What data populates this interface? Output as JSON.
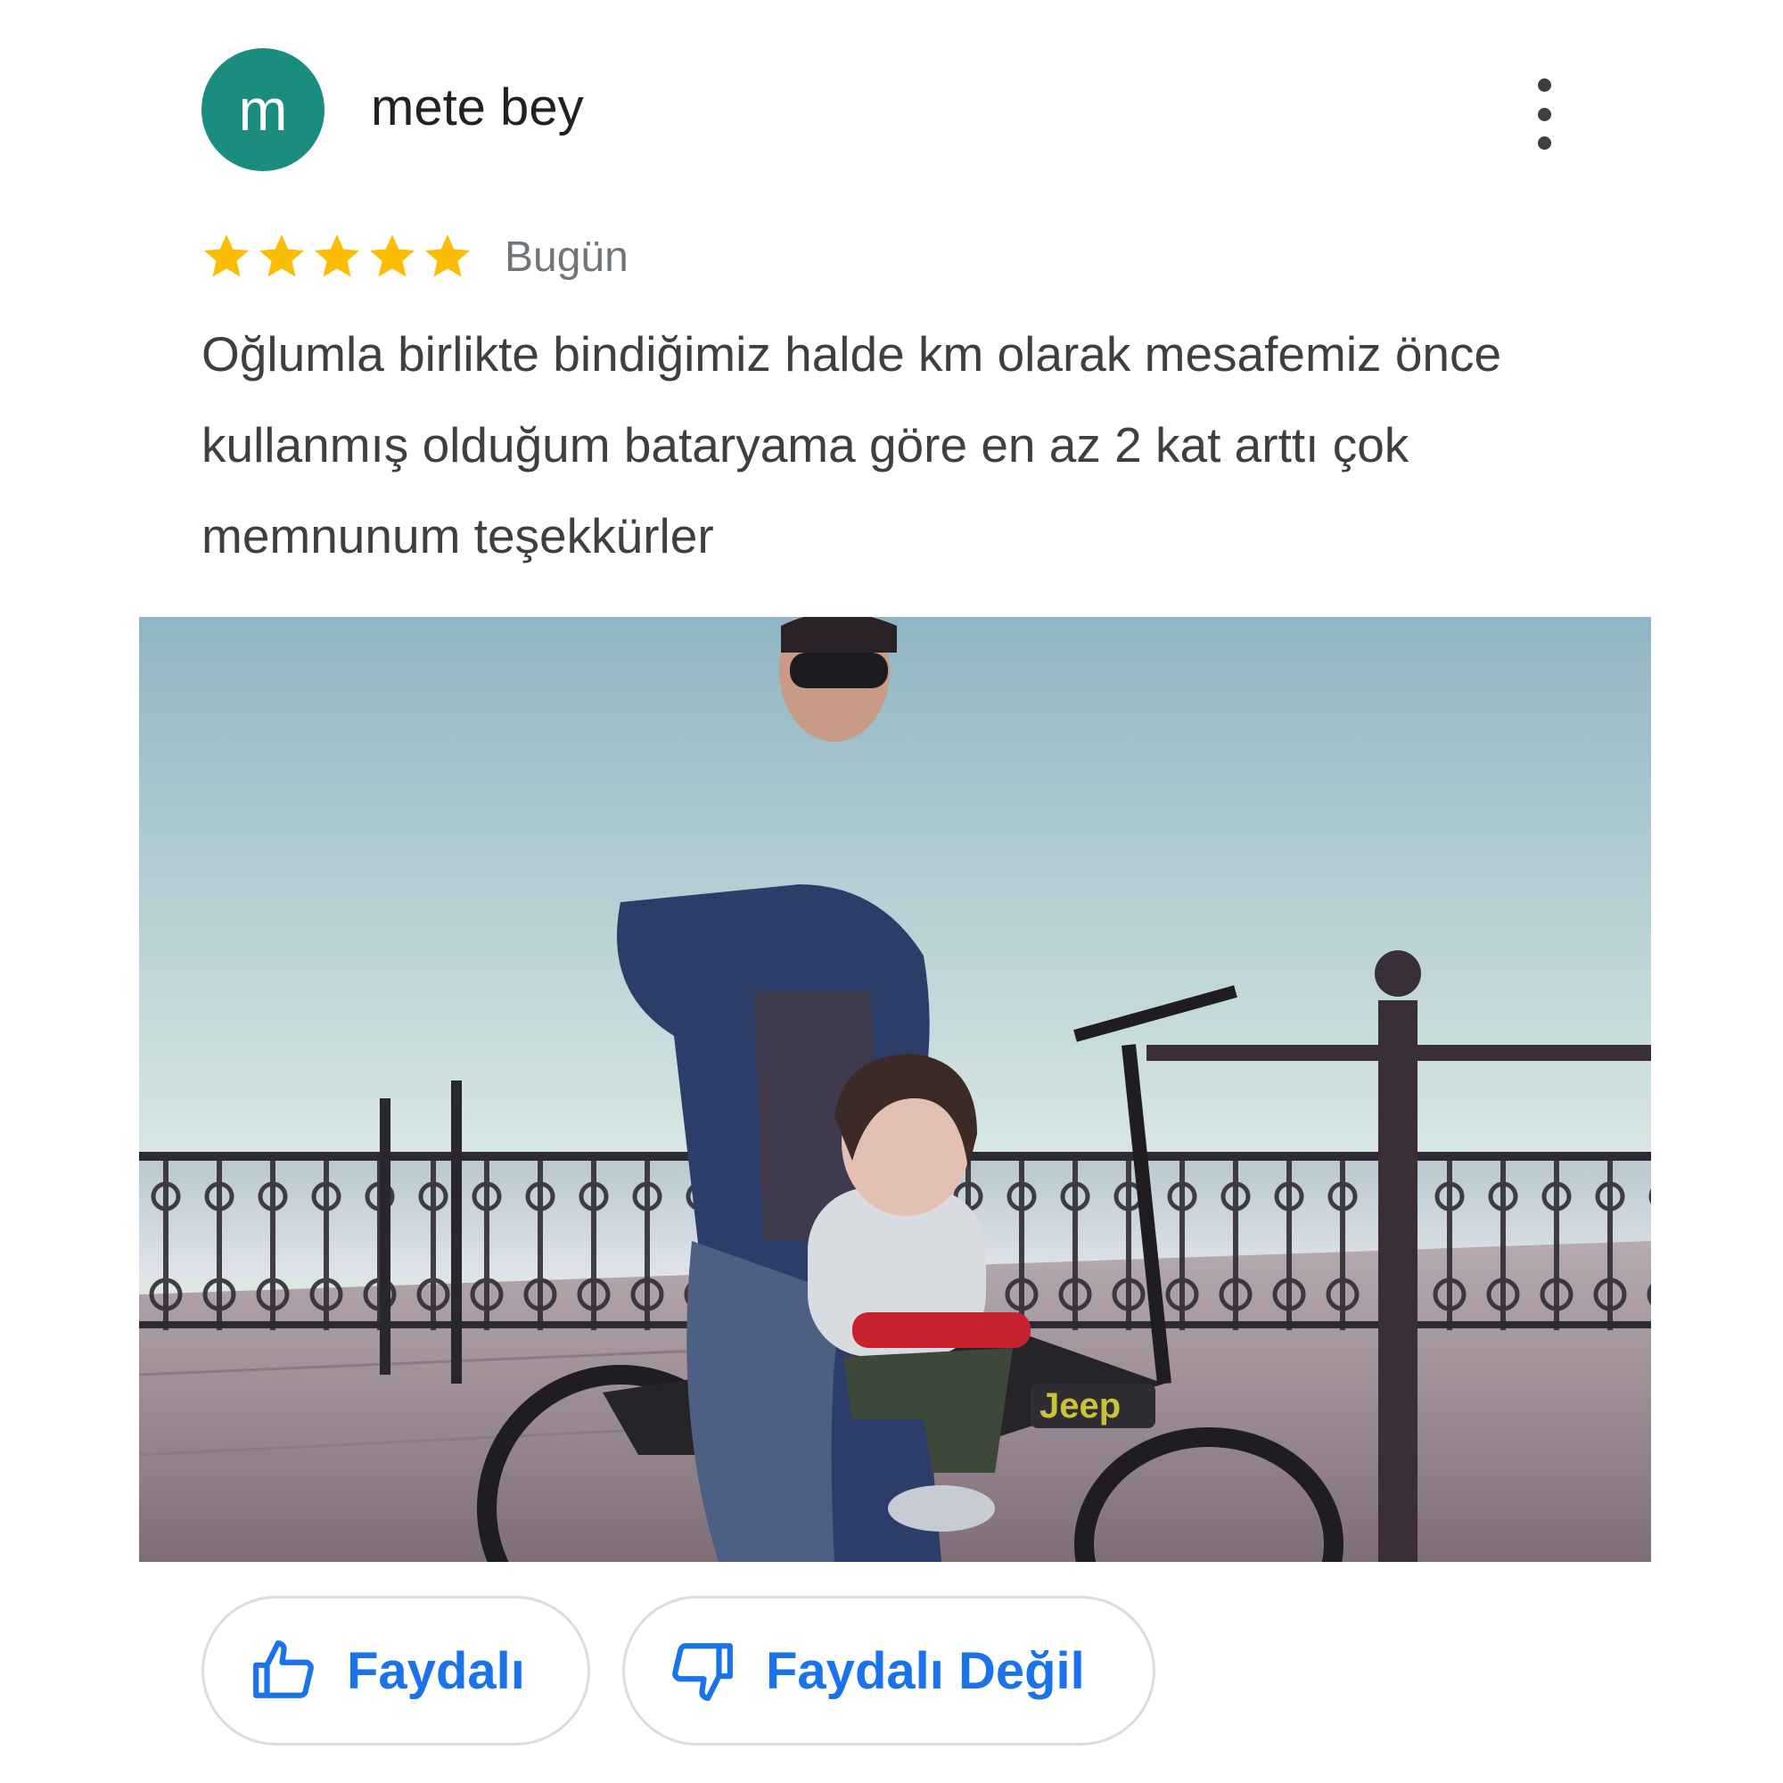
{
  "review": {
    "author": "mete bey",
    "avatar_letter": "m",
    "avatar_color": "#1a8d7e",
    "rating": 5,
    "rating_max": 5,
    "star_color": "#fbbc04",
    "date": "Bugün",
    "text": "Oğlumla birlikte bindiğimiz halde km olarak mesafemiz önce kullanmış olduğum bataryama göre en az 2 kat arttı çok memnunum teşekkürler",
    "more_icon": "more-vert-icon"
  },
  "photo": {
    "bike_brand": "Jeep"
  },
  "actions": {
    "helpful_label": "Faydalı",
    "helpful_icon": "thumb-up-icon",
    "not_helpful_label": "Faydalı Değil",
    "not_helpful_icon": "thumb-down-icon",
    "accent_color": "#1a73e8"
  }
}
